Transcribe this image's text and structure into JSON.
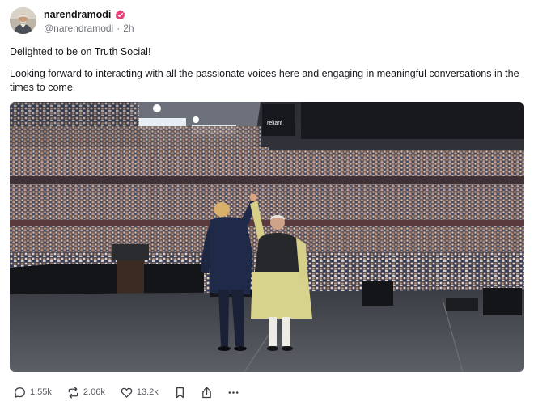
{
  "post": {
    "author": {
      "display_name": "narendramodi",
      "handle": "@narendramodi",
      "separator": "·",
      "timestamp": "2h",
      "verified": true,
      "verified_color": "#e8417a"
    },
    "paragraphs": [
      "Delighted to be on Truth Social!",
      "Looking forward to interacting with all the passionate voices here and engaging in meaningful conversations in the times to come."
    ],
    "media": {
      "type": "photo",
      "scoreboard_text": "reliant"
    },
    "actions": {
      "replies": "1.55k",
      "retruths": "2.06k",
      "likes": "13.2k"
    }
  },
  "icons": [
    "reply-icon",
    "retruth-icon",
    "like-icon",
    "bookmark-icon",
    "share-icon",
    "more-icon",
    "verified-badge-icon"
  ]
}
